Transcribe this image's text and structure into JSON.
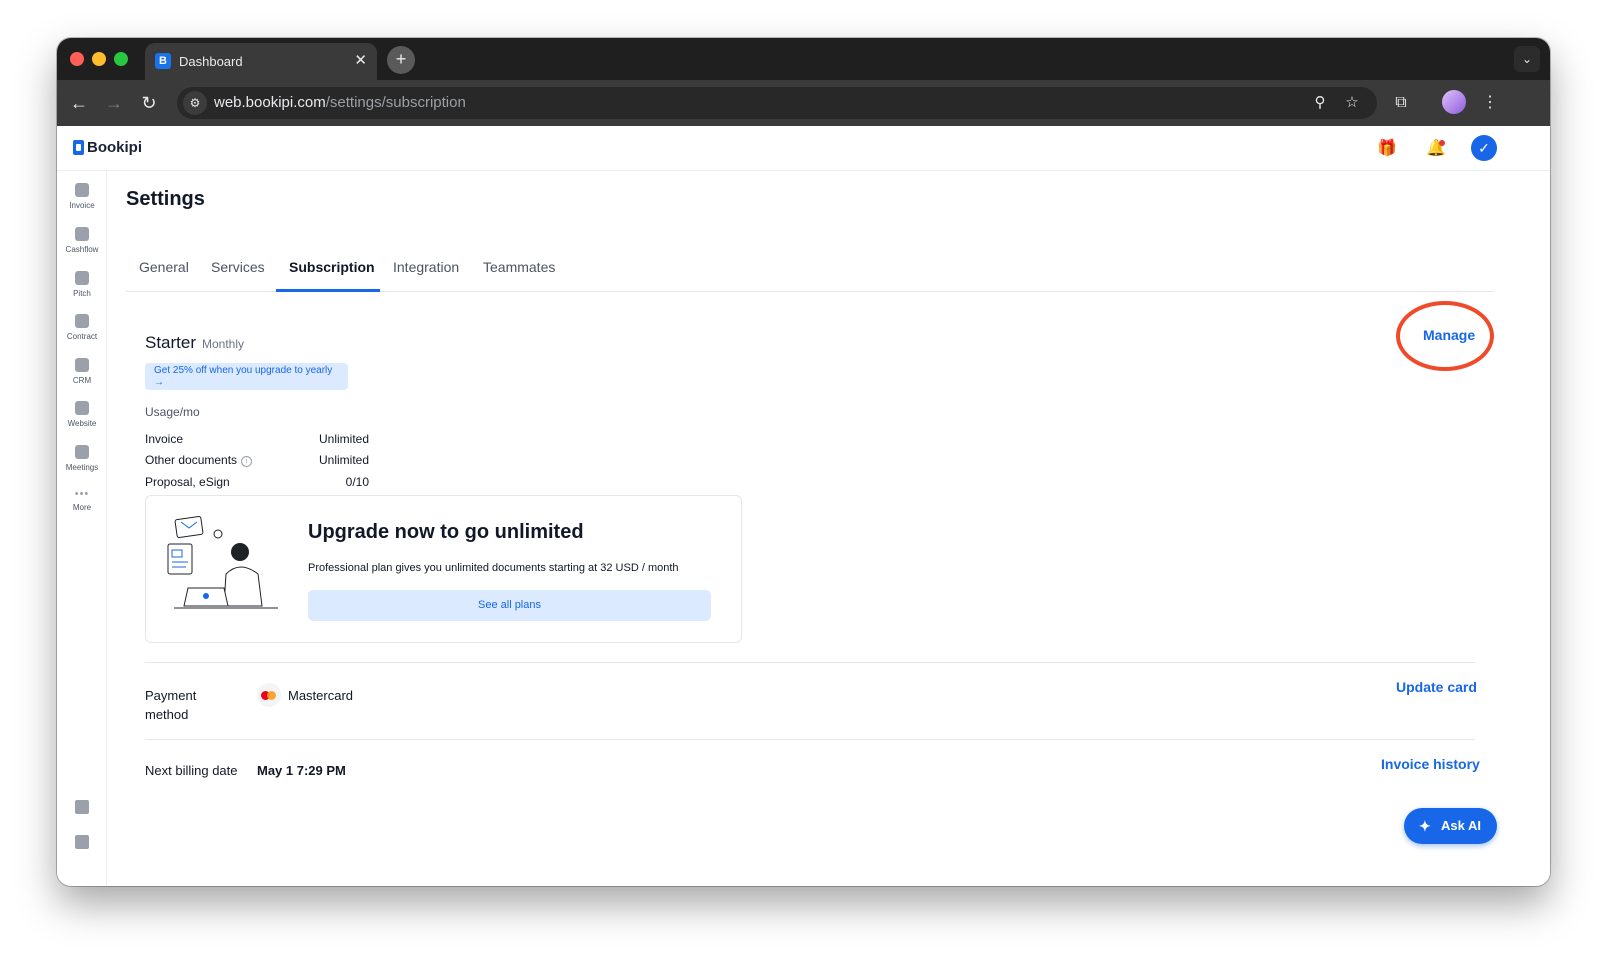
{
  "browser": {
    "tab_title": "Dashboard",
    "tab_favicon": "B",
    "close_glyph": "✕",
    "newtab_glyph": "+",
    "dropdown_glyph": "⌄",
    "url_host": "web.bookipi.com",
    "url_path": "/settings/subscription",
    "nav": {
      "back": "←",
      "forward": "→",
      "reload": "↻"
    },
    "icons": {
      "zoom": "⚲",
      "star": "☆",
      "extensions": "⧉",
      "menu": "⋮",
      "site_info": "⚙"
    }
  },
  "app": {
    "logo_text": "Bookipi",
    "avatar_glyph": "✓",
    "gift_glyph": "🎁",
    "bell_glyph": "🔔"
  },
  "sidebar": {
    "items": [
      {
        "label": "Invoice"
      },
      {
        "label": "Cashflow"
      },
      {
        "label": "Pitch"
      },
      {
        "label": "Contract"
      },
      {
        "label": "CRM"
      },
      {
        "label": "Website"
      },
      {
        "label": "Meetings"
      },
      {
        "label": "More"
      }
    ],
    "more_dots": "•••"
  },
  "settings": {
    "title": "Settings",
    "tabs": [
      "General",
      "Services",
      "Subscription",
      "Integration",
      "Teammates"
    ],
    "active_tab": "Subscription"
  },
  "subscription": {
    "plan_name": "Starter",
    "plan_period": "Monthly",
    "manage_label": "Manage",
    "promo_line1": "Get 25% off when you upgrade to yearly",
    "promo_arrow": "→",
    "usage_title": "Usage/mo",
    "usage": [
      {
        "label": "Invoice",
        "value": "Unlimited"
      },
      {
        "label": "Other documents",
        "value": "Unlimited"
      },
      {
        "label": "Proposal, eSign",
        "value": "0/10"
      }
    ],
    "info_glyph": "i",
    "upgrade_title": "Upgrade now to go unlimited",
    "upgrade_text": "Professional plan gives you unlimited documents starting at 32 USD / month",
    "see_plans_label": "See all plans",
    "payment_label": "Payment method",
    "card_name": "Mastercard",
    "update_card_label": "Update card",
    "billing_label": "Next billing date",
    "billing_value": "May 1 7:29 PM",
    "invoice_history_label": "Invoice history"
  },
  "ask_ai": {
    "label": "Ask AI",
    "glyph": "✦"
  },
  "colors": {
    "accent": "#1767e8",
    "highlight_ring": "#ef4b2b"
  }
}
